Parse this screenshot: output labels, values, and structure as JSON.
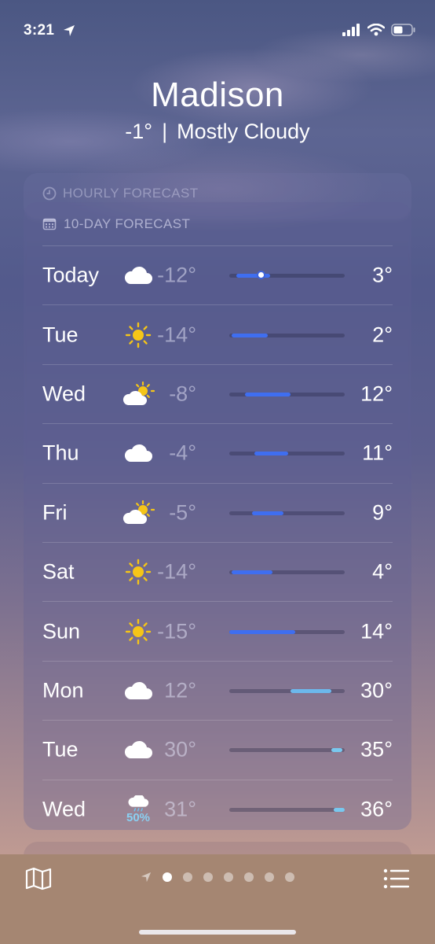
{
  "status": {
    "time": "3:21"
  },
  "location": {
    "city": "Madison",
    "temperature": "-1°",
    "separator": "|",
    "condition": "Mostly Cloudy"
  },
  "hourly": {
    "header": "HOURLY FORECAST"
  },
  "forecast": {
    "header": "10-DAY FORECAST",
    "scale": {
      "min": -15,
      "max": 36
    },
    "days": [
      {
        "day": "Today",
        "icon": "cloud-icon",
        "low": "-12°",
        "high": "3°",
        "lo_val": -12,
        "hi_val": 3,
        "current": -1,
        "color": "#3f6ef0"
      },
      {
        "day": "Tue",
        "icon": "sun-icon",
        "low": "-14°",
        "high": "2°",
        "lo_val": -14,
        "hi_val": 2,
        "color": "#3f6ef0"
      },
      {
        "day": "Wed",
        "icon": "partly-cloudy-icon",
        "low": "-8°",
        "high": "12°",
        "lo_val": -8,
        "hi_val": 12,
        "color": "#3f6ef0"
      },
      {
        "day": "Thu",
        "icon": "cloud-icon",
        "low": "-4°",
        "high": "11°",
        "lo_val": -4,
        "hi_val": 11,
        "color": "#3f6ef0"
      },
      {
        "day": "Fri",
        "icon": "partly-cloudy-icon",
        "low": "-5°",
        "high": "9°",
        "lo_val": -5,
        "hi_val": 9,
        "color": "#3f6ef0"
      },
      {
        "day": "Sat",
        "icon": "sun-icon",
        "low": "-14°",
        "high": "4°",
        "lo_val": -14,
        "hi_val": 4,
        "color": "#3f6ef0"
      },
      {
        "day": "Sun",
        "icon": "sun-icon",
        "low": "-15°",
        "high": "14°",
        "lo_val": -15,
        "hi_val": 14,
        "color": "#3f6ef0"
      },
      {
        "day": "Mon",
        "icon": "cloud-icon",
        "low": "12°",
        "high": "30°",
        "lo_val": 12,
        "hi_val": 30,
        "color": "#6cb8ec"
      },
      {
        "day": "Tue",
        "icon": "cloud-icon",
        "low": "30°",
        "high": "35°",
        "lo_val": 30,
        "hi_val": 35,
        "color": "#79c8ef"
      },
      {
        "day": "Wed",
        "icon": "rain-cloud-icon",
        "precip": "50%",
        "low": "31°",
        "high": "36°",
        "lo_val": 31,
        "hi_val": 36,
        "color": "#79c8ef"
      }
    ]
  },
  "pager": {
    "pages": 7,
    "active": 0
  },
  "toolbar": {
    "map_icon": "map-icon",
    "list_icon": "list-icon",
    "location_icon": "location-arrow-icon"
  }
}
